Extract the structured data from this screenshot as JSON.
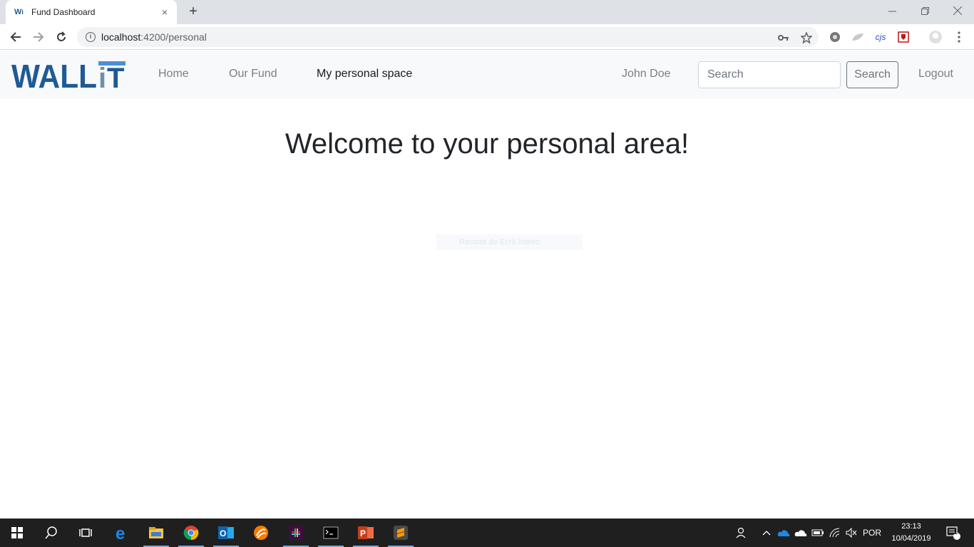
{
  "browser": {
    "tab": {
      "favicon": "W⁠i",
      "title": "Fund Dashboard",
      "close": "×"
    },
    "new_tab": "+",
    "window_controls": {
      "minimize": "—",
      "restore": "❐",
      "close": "✕"
    },
    "url": {
      "host": "localhost",
      "path": ":4200/personal"
    },
    "icons": [
      "back-icon",
      "forward-icon",
      "reload-icon",
      "info-icon",
      "key-icon",
      "star-icon",
      "extension-gear-icon",
      "extension-leaf-icon",
      "extension-cjs-icon",
      "extension-shield-icon",
      "profile-icon",
      "menu-icon"
    ],
    "ext_cjs_label": "cjs"
  },
  "navbar": {
    "logo_text": "WALLiT",
    "links": [
      {
        "label": "Home",
        "active": false
      },
      {
        "label": "Our Fund",
        "active": false
      },
      {
        "label": "My personal space",
        "active": true
      }
    ],
    "user_name": "John Doe",
    "search_placeholder": "Search",
    "search_button": "Search",
    "logout": "Logout"
  },
  "main": {
    "heading": "Welcome to your personal area!",
    "overlay_text": "Recorte de Ecrã Inteiro"
  },
  "taskbar": {
    "apps": [
      "windows-start-icon",
      "search-icon",
      "task-view-icon",
      "edge-icon",
      "file-explorer-icon",
      "chrome-icon",
      "outlook-icon",
      "blender-icon",
      "slack-icon",
      "terminal-icon",
      "powerpoint-icon",
      "sublime-icon"
    ],
    "language": "POR",
    "time": "23:13",
    "date": "10/04/2019",
    "notifications": "1"
  },
  "colors": {
    "logo_blue": "#1f5a96",
    "navbar_bg": "#f8f9fa",
    "taskbar_bg": "#1f1f1f"
  }
}
